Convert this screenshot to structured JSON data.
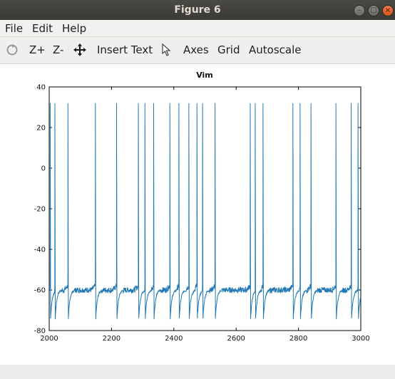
{
  "window": {
    "title": "Figure 6"
  },
  "menu": {
    "file": "File",
    "edit": "Edit",
    "help": "Help"
  },
  "toolbar": {
    "rotate_icon": "rotate-icon",
    "zoom_in": "Z+",
    "zoom_out": "Z-",
    "pan_icon": "pan-icon",
    "insert_text": "Insert Text",
    "select_icon": "pointer-icon",
    "axes": "Axes",
    "grid": "Grid",
    "autoscale": "Autoscale"
  },
  "colors": {
    "line": "#1f77b4",
    "titlebar": "#3c3b37",
    "close": "#e95420"
  },
  "chart_data": {
    "type": "line",
    "title": "Vim",
    "xlabel": "",
    "ylabel": "",
    "xlim": [
      2000,
      3000
    ],
    "ylim": [
      -80,
      40
    ],
    "xticks": [
      2000,
      2200,
      2400,
      2600,
      2800,
      3000
    ],
    "yticks": [
      -80,
      -60,
      -40,
      -20,
      0,
      20,
      40
    ],
    "grid": false,
    "series": [
      {
        "resting": -60,
        "spike_peak": 32,
        "trough": -74,
        "spike_times": [
          2003,
          2018,
          2060,
          2148,
          2216,
          2286,
          2307,
          2335,
          2387,
          2416,
          2448,
          2474,
          2492,
          2532,
          2645,
          2661,
          2686,
          2782,
          2805,
          2840,
          2920,
          2969,
          2991
        ]
      }
    ]
  }
}
